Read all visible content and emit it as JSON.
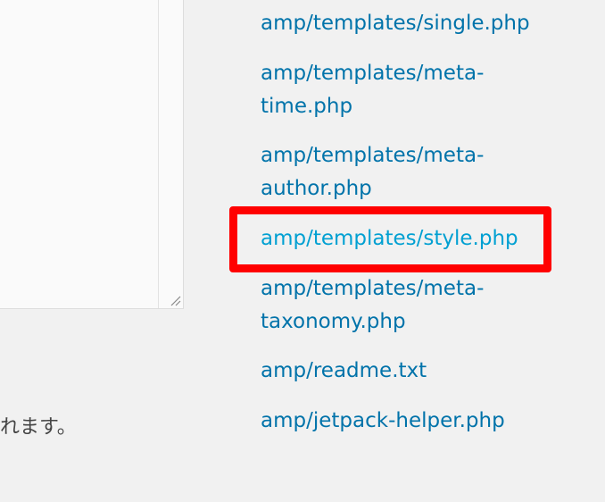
{
  "notice": {
    "text": "れます。"
  },
  "files": [
    {
      "line1": "amp/templates/single.php",
      "line2": ""
    },
    {
      "line1": "amp/templates/meta-",
      "line2": "time.php"
    },
    {
      "line1": "amp/templates/meta-",
      "line2": "author.php"
    },
    {
      "line1": "amp/templates/style.php",
      "line2": ""
    },
    {
      "line1": "amp/templates/meta-",
      "line2": "taxonomy.php"
    },
    {
      "line1": "amp/readme.txt",
      "line2": ""
    },
    {
      "line1": "amp/jetpack-helper.php",
      "line2": ""
    }
  ],
  "colors": {
    "link": "#0073aa",
    "current_link": "#00a0d2",
    "highlight": "#ff0000",
    "background": "#f1f1f1"
  }
}
